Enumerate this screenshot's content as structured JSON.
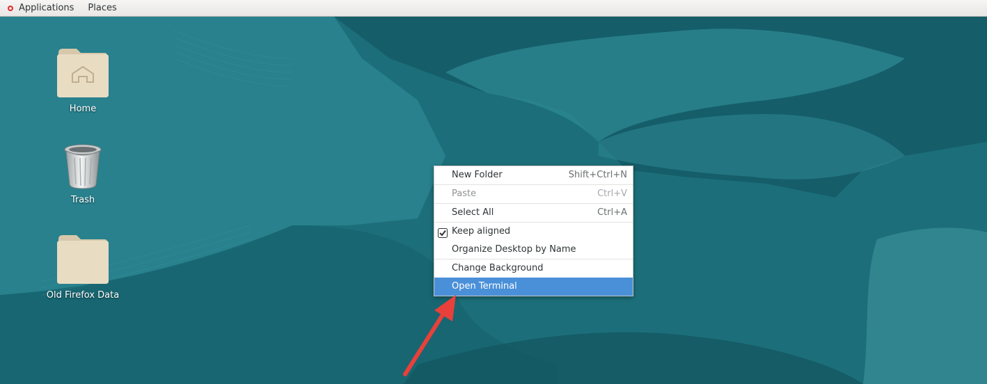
{
  "topbar": {
    "applications_label": "Applications",
    "places_label": "Places"
  },
  "desktop_icons": [
    {
      "label": "Home"
    },
    {
      "label": "Trash"
    },
    {
      "label": "Old Firefox Data"
    }
  ],
  "context_menu": {
    "items": [
      {
        "label": "New Folder",
        "accel": "Shift+Ctrl+N",
        "enabled": true
      },
      {
        "label": "Paste",
        "accel": "Ctrl+V",
        "enabled": false
      },
      {
        "label": "Select All",
        "accel": "Ctrl+A",
        "enabled": true
      },
      {
        "label": "Keep aligned",
        "checked": true,
        "enabled": true
      },
      {
        "label": "Organize Desktop by Name",
        "enabled": true
      },
      {
        "label": "Change Background",
        "enabled": true
      },
      {
        "label": "Open Terminal",
        "enabled": true,
        "highlighted": true
      }
    ]
  },
  "colors": {
    "desktop_base": "#1c6f7a",
    "menu_highlight": "#4a90d9",
    "arrow": "#e8403a"
  },
  "icons": [
    "app-menu-icon",
    "home-folder-icon",
    "trash-icon",
    "folder-icon",
    "checkmark-icon",
    "annotation-arrow"
  ]
}
